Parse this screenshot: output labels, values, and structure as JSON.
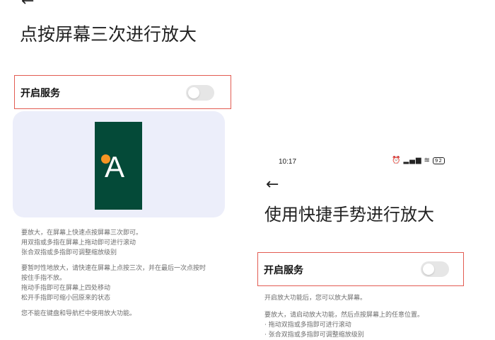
{
  "left_screen": {
    "back_icon": "back-arrow",
    "title": "点按屏幕三次进行放大",
    "toggle_label": "开启服务",
    "toggle_on": false,
    "preview_letter": "A",
    "description_paragraphs": [
      [
        "要放大，在屏幕上快速点按屏幕三次即可。",
        "用双指或多指在屏幕上拖动即可进行滚动",
        "张合双指或多指即可调整缩放级别"
      ],
      [
        "要暂时性地放大，请快速在屏幕上点按三次，并在最后一次点按时",
        "按住手指不放。",
        "拖动手指即可在屏幕上四处移动",
        "松开手指即可缩小回原来的状态"
      ],
      [
        "您不能在键盘和导航栏中使用放大功能。"
      ]
    ]
  },
  "right_screen": {
    "status_bar": {
      "time": "10:17",
      "icons": [
        "alarm-icon",
        "signal-icon",
        "wifi-icon",
        "battery-icon"
      ],
      "battery_level": "92"
    },
    "back_icon": "back-arrow",
    "title": "使用快捷手势进行放大",
    "toggle_label": "开启服务",
    "toggle_on": false,
    "description_paragraphs": [
      [
        "开启放大功能后，您可以放大屏幕。"
      ],
      [
        "要放大，请启动放大功能，然后点按屏幕上的任意位置。",
        "· 拖动双指或多指即可进行滚动",
        "· 张合双指或多指即可调整缩放级别"
      ]
    ]
  },
  "colors": {
    "highlight_border": "#e25c52",
    "preview_bg": "#eceefa",
    "preview_tile": "#044a38",
    "preview_dot": "#f79523",
    "switch_off": "#e6e6e6"
  }
}
